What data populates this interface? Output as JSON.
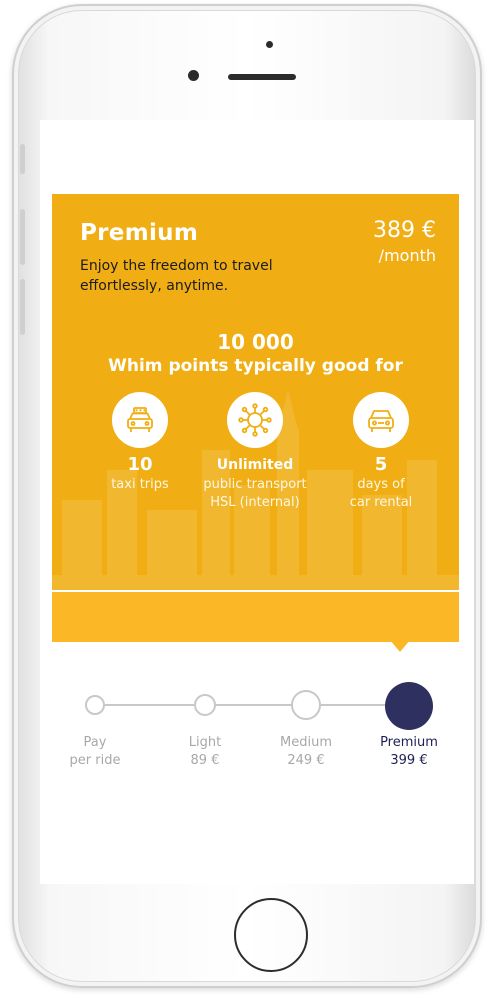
{
  "plan": {
    "name": "Premium",
    "description": "Enjoy the freedom to travel effortlessly, anytime.",
    "price": "389 €",
    "period": "/month"
  },
  "points": {
    "amount": "10 000",
    "label": "Whim points typically good for"
  },
  "features": [
    {
      "icon": "taxi-icon",
      "value": "10",
      "line1": "taxi trips",
      "line2": ""
    },
    {
      "icon": "transit-network-icon",
      "value": "Unlimited",
      "line1": "public transport",
      "line2": "HSL (internal)"
    },
    {
      "icon": "car-icon",
      "value": "5",
      "line1": "days of",
      "line2": "car rental"
    }
  ],
  "tiers": [
    {
      "name": "Pay",
      "sub": "per ride"
    },
    {
      "name": "Light",
      "sub": "89 €"
    },
    {
      "name": "Medium",
      "sub": "249 €"
    },
    {
      "name": "Premium",
      "sub": "399 €"
    }
  ],
  "selected_tier": "Premium",
  "colors": {
    "card": "#f0ae14",
    "band": "#fbb726",
    "selected_node": "#2e3060",
    "inactive_node": "#c8c8c8"
  }
}
